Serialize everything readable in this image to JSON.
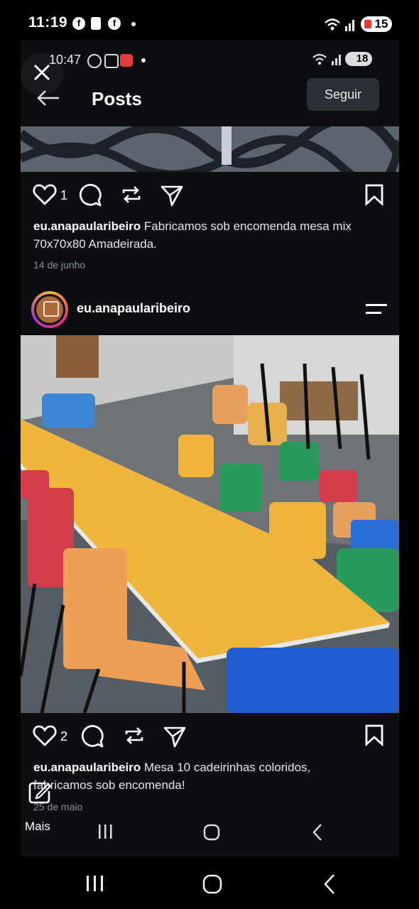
{
  "status_bar": {
    "time": "11:19",
    "battery": "15"
  },
  "inner_status_bar": {
    "time": "10:47",
    "battery": "18"
  },
  "header": {
    "title": "Posts",
    "follow_label": "Seguir"
  },
  "posts": [
    {
      "likes": "1",
      "username": "eu.anapaularibeiro",
      "caption": "Fabricamos sob encomenda mesa mix 70x70x80 Amadeirada.",
      "date": "14 de junho"
    },
    {
      "username": "eu.anapaularibeiro",
      "likes": "2",
      "caption_line1": "Mesa 10 cadeirinhas coloridos,",
      "caption_line2": "fabricamos sob encomenda!",
      "date": "25 de maio"
    }
  ],
  "bottom": {
    "more_label": "Mais"
  },
  "icons": {
    "notif": [
      "facebook-icon",
      "alert-icon",
      "facebook-icon"
    ],
    "inner_notif": [
      "whatsapp-icon",
      "screenshot-icon",
      "app-badge-icon"
    ],
    "system": [
      "wifi-icon",
      "signal-icon",
      "battery-icon"
    ]
  },
  "colors": {
    "background": "#0c0e12",
    "button": "#2b2f36",
    "date": "#8b8f96"
  }
}
